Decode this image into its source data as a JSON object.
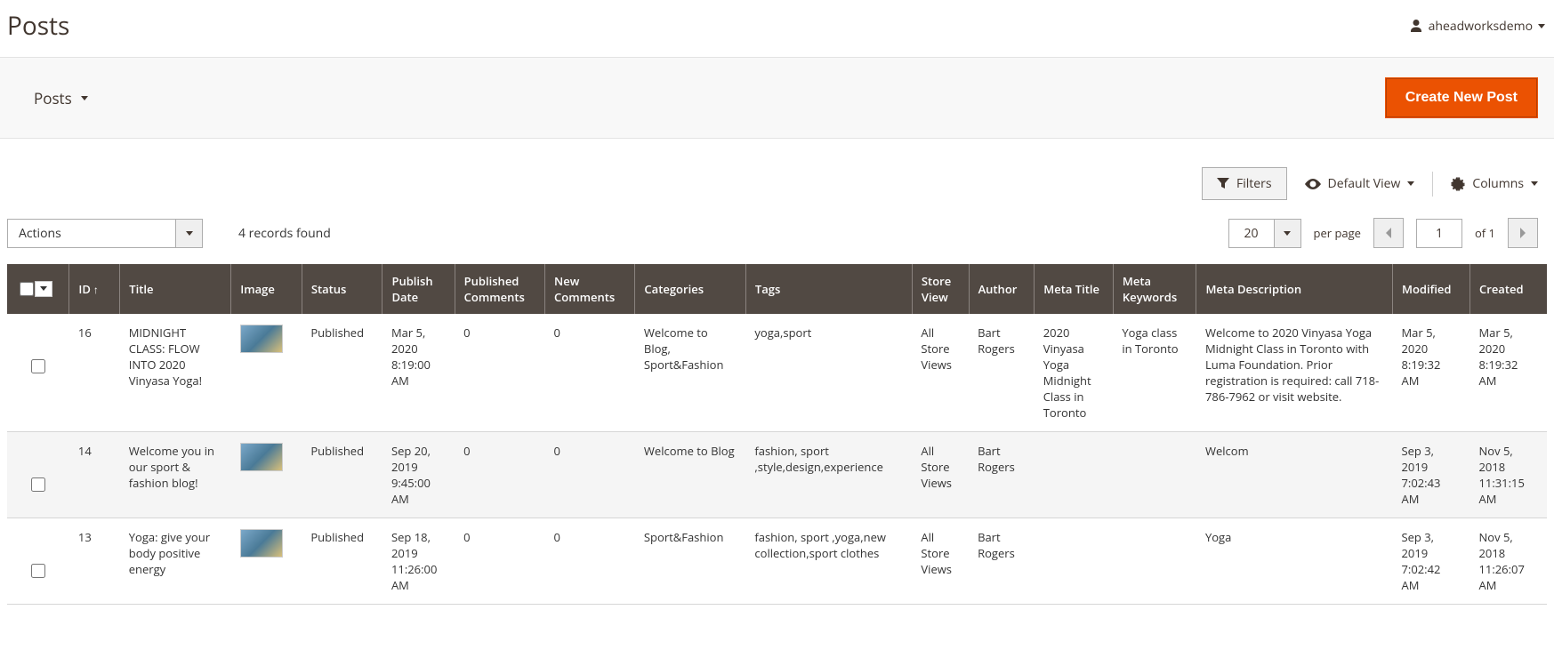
{
  "page_title": "Posts",
  "account_name": "aheadworksdemo",
  "toolbar": {
    "posts_dd_label": "Posts",
    "create_button_label": "Create New Post"
  },
  "controls": {
    "filters_label": "Filters",
    "default_view_label": "Default View",
    "columns_label": "Columns"
  },
  "actions": {
    "label": "Actions"
  },
  "records_found": "4 records found",
  "pager": {
    "per_page_value": "20",
    "per_page_label": "per page",
    "page_value": "1",
    "of_label": "of 1"
  },
  "columns": {
    "id": "ID",
    "title": "Title",
    "image": "Image",
    "status": "Status",
    "publish_date": "Publish Date",
    "published_comments": "Published Comments",
    "new_comments": "New Comments",
    "categories": "Categories",
    "tags": "Tags",
    "store_view": "Store View",
    "author": "Author",
    "meta_title": "Meta Title",
    "meta_keywords": "Meta Keywords",
    "meta_description": "Meta Description",
    "modified": "Modified",
    "created": "Created"
  },
  "rows": [
    {
      "id": "16",
      "title": "MIDNIGHT CLASS: FLOW INTO 2020 Vinyasa Yoga!",
      "status": "Published",
      "publish_date": "Mar 5, 2020 8:19:00 AM",
      "published_comments": "0",
      "new_comments": "0",
      "categories": "Welcome to Blog, Sport&Fashion",
      "tags": "yoga,sport",
      "store_view": "All Store Views",
      "author": "Bart Rogers",
      "meta_title": "2020 Vinyasa Yoga Midnight Class in Toronto",
      "meta_keywords": "Yoga class in Toronto",
      "meta_description": "Welcome to 2020 Vinyasa Yoga Midnight Class in Toronto with Luma Foundation. Prior registration is required: call 718-786-7962 or visit website.",
      "modified": "Mar 5, 2020 8:19:32 AM",
      "created": "Mar 5, 2020 8:19:32 AM"
    },
    {
      "id": "14",
      "title": "Welcome you in our sport & fashion blog!",
      "status": "Published",
      "publish_date": "Sep 20, 2019 9:45:00 AM",
      "published_comments": "0",
      "new_comments": "0",
      "categories": "Welcome to Blog",
      "tags": "fashion, sport ,style,design,experience",
      "store_view": "All Store Views",
      "author": "Bart Rogers",
      "meta_title": "",
      "meta_keywords": "",
      "meta_description": "Welcom",
      "modified": "Sep 3, 2019 7:02:43 AM",
      "created": "Nov 5, 2018 11:31:15 AM"
    },
    {
      "id": "13",
      "title": "Yoga: give your body positive energy",
      "status": "Published",
      "publish_date": "Sep 18, 2019 11:26:00 AM",
      "published_comments": "0",
      "new_comments": "0",
      "categories": "Sport&Fashion",
      "tags": "fashion, sport ,yoga,new collection,sport clothes",
      "store_view": "All Store Views",
      "author": "Bart Rogers",
      "meta_title": "",
      "meta_keywords": "",
      "meta_description": "Yoga",
      "modified": "Sep 3, 2019 7:02:42 AM",
      "created": "Nov 5, 2018 11:26:07 AM"
    }
  ]
}
